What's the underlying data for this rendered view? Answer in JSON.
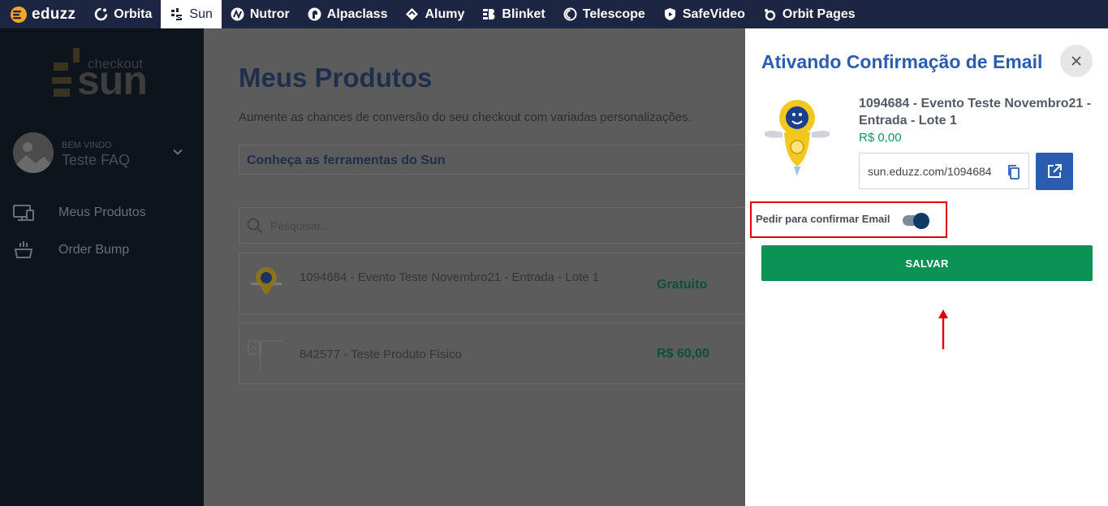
{
  "topnav": {
    "brand": "eduzz",
    "items": [
      {
        "label": "Orbita",
        "icon": "orbita-icon",
        "active": false
      },
      {
        "label": "Sun",
        "icon": "sun-icon",
        "active": true
      },
      {
        "label": "Nutror",
        "icon": "nutror-icon",
        "active": false
      },
      {
        "label": "Alpaclass",
        "icon": "alpaclass-icon",
        "active": false
      },
      {
        "label": "Alumy",
        "icon": "alumy-icon",
        "active": false
      },
      {
        "label": "Blinket",
        "icon": "blinket-icon",
        "active": false
      },
      {
        "label": "Telescope",
        "icon": "telescope-icon",
        "active": false
      },
      {
        "label": "SafeVideo",
        "icon": "safevideo-icon",
        "active": false
      },
      {
        "label": "Orbit Pages",
        "icon": "orbit-pages-icon",
        "active": false
      }
    ]
  },
  "sidebar": {
    "logo_small": "checkout",
    "logo_word": "sun",
    "welcome": "BEM VINDO",
    "user_name": "Teste FAQ",
    "menu": [
      {
        "label": "Meus Produtos",
        "icon": "monitor-icon"
      },
      {
        "label": "Order Bump",
        "icon": "basket-icon"
      }
    ]
  },
  "main": {
    "title": "Meus Produtos",
    "subtitle": "Aumente as chances de conversão do seu checkout com variadas personalizações.",
    "tools_label": "Conheça as ferramentas do Sun",
    "search_placeholder": "Pesquisar...",
    "products": [
      {
        "name": "1094684 - Evento Teste Novembro21 - Entrada - Lote 1",
        "price": "Gratuito"
      },
      {
        "name": "842577 - Teste Produto Físico",
        "price": "R$ 60,00"
      }
    ]
  },
  "panel": {
    "title": "Ativando Confirmação de Email",
    "product_name": "1094684 - Evento Teste Novembro21 - Entrada - Lote 1",
    "product_price": "R$ 0,00",
    "link": "sun.eduzz.com/1094684",
    "toggle_label": "Pedir para confirmar Email",
    "toggle_on": true,
    "save_label": "SALVAR"
  },
  "colors": {
    "nav_bg": "#1c2541",
    "sidebar_bg": "#0d141b",
    "accent_blue": "#2a5db0",
    "save_green": "#0d9255",
    "highlight_red": "#e00000"
  }
}
